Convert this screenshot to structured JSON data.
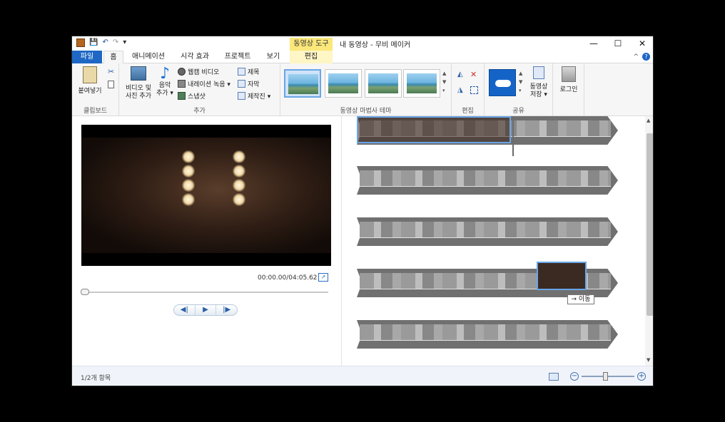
{
  "window": {
    "title": "내 동영상 - 무비 메이커",
    "context_tab_label": "동영상 도구",
    "controls": [
      "—",
      "☐",
      "✕"
    ]
  },
  "tabs": [
    {
      "label": "파일"
    },
    {
      "label": "홈"
    },
    {
      "label": "애니메이션"
    },
    {
      "label": "시각 효과"
    },
    {
      "label": "프로젝트"
    },
    {
      "label": "보기"
    },
    {
      "label": "편집"
    }
  ],
  "ribbon": {
    "clipboard": {
      "paste_label": "붙여넣기",
      "group_label": "클립보드"
    },
    "add": {
      "add_video_photo_l1": "비디오 및",
      "add_video_photo_l2": "사진 추가",
      "add_music_l1": "음악",
      "add_music_l2": "추가 ▾",
      "webcam": "웹캠 비디오",
      "narration": "내레이션 녹음 ▾",
      "snapshot": "스냅샷",
      "title": "제목",
      "caption": "자막",
      "credits": "제작진 ▾",
      "group_label": "추가"
    },
    "themes": {
      "group_label": "동영상 마법사 테마"
    },
    "edit": {
      "group_label": "편집"
    },
    "share": {
      "save_l1": "동영상",
      "save_l2": "저장 ▾",
      "group_label": "공유"
    },
    "signin": {
      "label": "로그인"
    }
  },
  "preview": {
    "time": "00:00.00/04:05.62",
    "playback": {
      "prev": "◀|",
      "play": "▶",
      "next": "|▶"
    }
  },
  "storyboard": {
    "move_tooltip": "→ 이동"
  },
  "status": {
    "text": "1/2개 항목",
    "zoom_out": "−",
    "zoom_in": "+",
    "zoom_level": 0.45
  },
  "colors": {
    "file_tab": "#1e67c4",
    "context_tab": "#fbe77a",
    "selection": "#6aa5e6"
  }
}
